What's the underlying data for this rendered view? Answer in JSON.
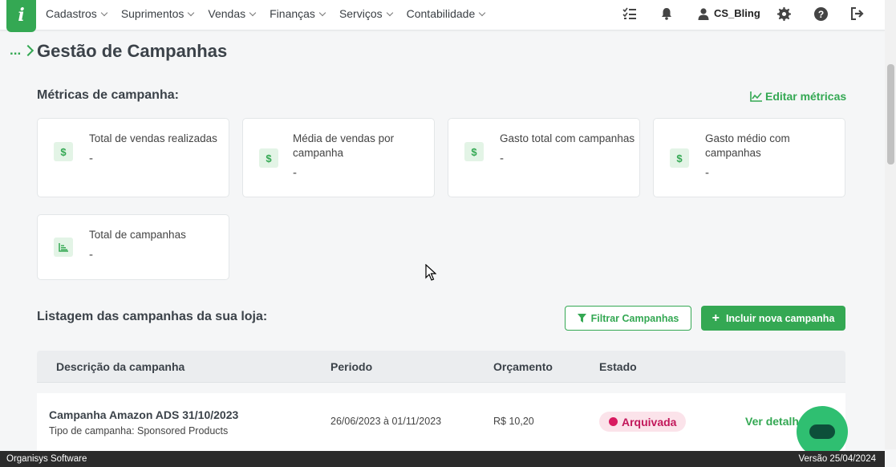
{
  "app": {
    "logo_text": "i",
    "brand_color": "#34a853"
  },
  "nav": {
    "menu": [
      "Cadastros",
      "Suprimentos",
      "Vendas",
      "Finanças",
      "Serviços",
      "Contabilidade"
    ],
    "user_name": "CS_Bling",
    "icons": [
      "checklist-icon",
      "bell-icon",
      "user-icon",
      "gear-icon",
      "help-icon",
      "logout-icon"
    ]
  },
  "page": {
    "breadcrumb": "...",
    "title": "Gestão de Campanhas"
  },
  "metrics": {
    "section_title": "Métricas de campanha:",
    "edit_label": "Editar métricas",
    "cards": [
      {
        "label": "Total de vendas realizadas",
        "value": "-",
        "icon": "dollar-icon",
        "icon_glyph": "$"
      },
      {
        "label": "Média de vendas por campanha",
        "value": "-",
        "icon": "dollar-icon",
        "icon_glyph": "$"
      },
      {
        "label": "Gasto total com campanhas",
        "value": "-",
        "icon": "dollar-icon",
        "icon_glyph": "$"
      },
      {
        "label": "Gasto médio com campanhas",
        "value": "-",
        "icon": "dollar-icon",
        "icon_glyph": "$"
      },
      {
        "label": "Total de campanhas",
        "value": "-",
        "icon": "bar-chart-icon"
      }
    ]
  },
  "listing": {
    "section_title": "Listagem das campanhas da sua loja:",
    "filter_label": "Filtrar Campanhas",
    "add_label": "Incluir nova campanha",
    "columns": [
      "Descrição da campanha",
      "Periodo",
      "Orçamento",
      "Estado"
    ],
    "rows": [
      {
        "name": "Campanha Amazon ADS 31/10/2023",
        "type": "Tipo de campanha: Sponsored Products",
        "period": "26/06/2023 à 01/11/2023",
        "budget": "R$ 10,20",
        "status": "Arquivada",
        "action": "Ver detalh"
      }
    ]
  },
  "footer": {
    "left": "Organisys Software",
    "right": "Versão 25/04/2024"
  }
}
